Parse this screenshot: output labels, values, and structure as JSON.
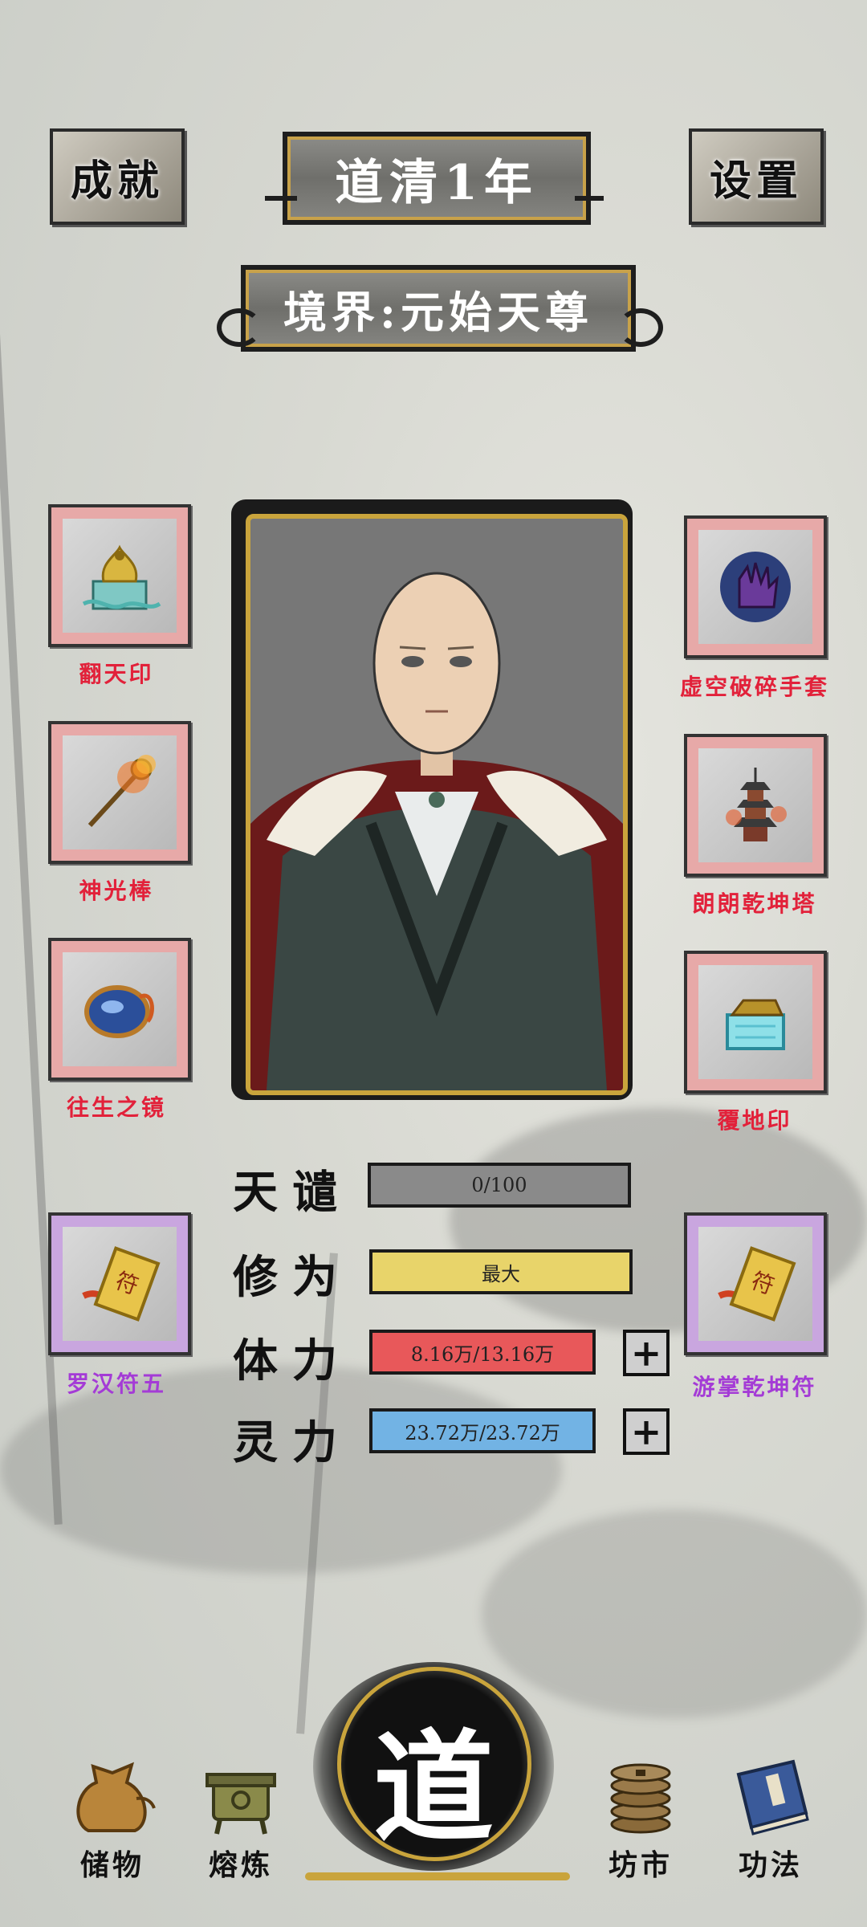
{
  "header": {
    "achievements_label": "成就",
    "year_title": "道清1年",
    "settings_label": "设置",
    "realm_title": "境界:元始天尊"
  },
  "equipment_left": [
    {
      "name": "翻天印",
      "icon": "dragon-seal-icon"
    },
    {
      "name": "神光棒",
      "icon": "fire-staff-icon"
    },
    {
      "name": "往生之镜",
      "icon": "mirror-icon"
    }
  ],
  "equipment_right": [
    {
      "name": "虚空破碎手套",
      "icon": "glove-icon"
    },
    {
      "name": "朗朗乾坤塔",
      "icon": "pagoda-icon"
    },
    {
      "name": "覆地印",
      "icon": "earth-seal-icon"
    }
  ],
  "talismans": {
    "left": {
      "name": "罗汉符五",
      "icon": "talisman-icon"
    },
    "right": {
      "name": "游掌乾坤符",
      "icon": "talisman-icon"
    }
  },
  "stats": {
    "tribulation": {
      "label": "天谴",
      "value_text": "0/100",
      "fraction": 0.0,
      "color": "#8a8a8a"
    },
    "cultivation": {
      "label": "修为",
      "value_text": "最大",
      "fraction": 1.0,
      "color": "#e8d46a"
    },
    "stamina": {
      "label": "体力",
      "value_text": "8.16万/13.16万",
      "fraction": 1.0,
      "color": "#e8585a"
    },
    "spirit": {
      "label": "灵力",
      "value_text": "23.72万/23.72万",
      "fraction": 1.0,
      "color": "#72b3e4"
    }
  },
  "nav": {
    "storage": "储物",
    "refine": "熔炼",
    "center": "道",
    "market": "坊市",
    "skills": "功法"
  },
  "colors": {
    "slot_red": "#e7a9a8",
    "slot_purple": "#c9a6df",
    "label_red": "#e2213a",
    "label_purple": "#a43bd6",
    "gold": "#c9a43c"
  }
}
